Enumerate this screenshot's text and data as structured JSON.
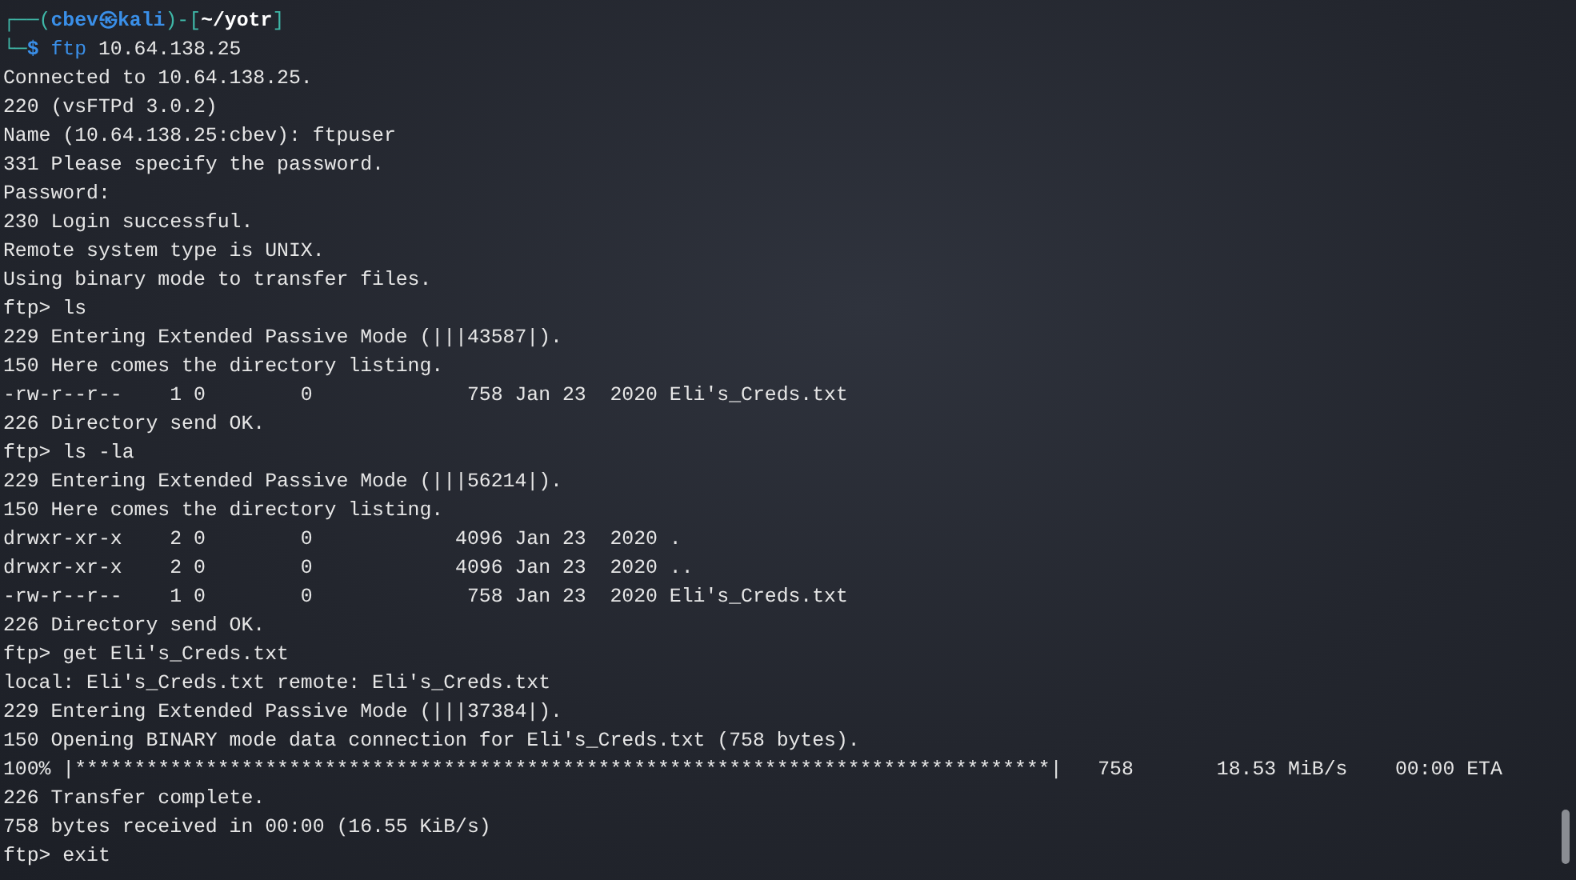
{
  "prompt": {
    "top_prefix": "┌──(",
    "user": "cbev",
    "at": "㉿",
    "host": "kali",
    "mid": ")-[",
    "path": "~/yotr",
    "end": "]",
    "bottom_prefix": "└─",
    "symbol": "$",
    "command": "ftp",
    "args": "10.64.138.25"
  },
  "lines": [
    "Connected to 10.64.138.25.",
    "220 (vsFTPd 3.0.2)",
    "Name (10.64.138.25:cbev): ftpuser",
    "331 Please specify the password.",
    "Password:",
    "230 Login successful.",
    "Remote system type is UNIX.",
    "Using binary mode to transfer files.",
    "ftp> ls",
    "229 Entering Extended Passive Mode (|||43587|).",
    "150 Here comes the directory listing.",
    "-rw-r--r--    1 0        0             758 Jan 23  2020 Eli's_Creds.txt",
    "226 Directory send OK.",
    "ftp> ls -la",
    "229 Entering Extended Passive Mode (|||56214|).",
    "150 Here comes the directory listing.",
    "drwxr-xr-x    2 0        0            4096 Jan 23  2020 .",
    "drwxr-xr-x    2 0        0            4096 Jan 23  2020 ..",
    "-rw-r--r--    1 0        0             758 Jan 23  2020 Eli's_Creds.txt",
    "226 Directory send OK.",
    "ftp> get Eli's_Creds.txt",
    "local: Eli's_Creds.txt remote: Eli's_Creds.txt",
    "229 Entering Extended Passive Mode (|||37384|).",
    "150 Opening BINARY mode data connection for Eli's_Creds.txt (758 bytes).",
    "100% |**********************************************************************************|   758       18.53 MiB/s    00:00 ETA",
    "226 Transfer complete.",
    "758 bytes received in 00:00 (16.55 KiB/s)",
    "ftp> exit"
  ]
}
